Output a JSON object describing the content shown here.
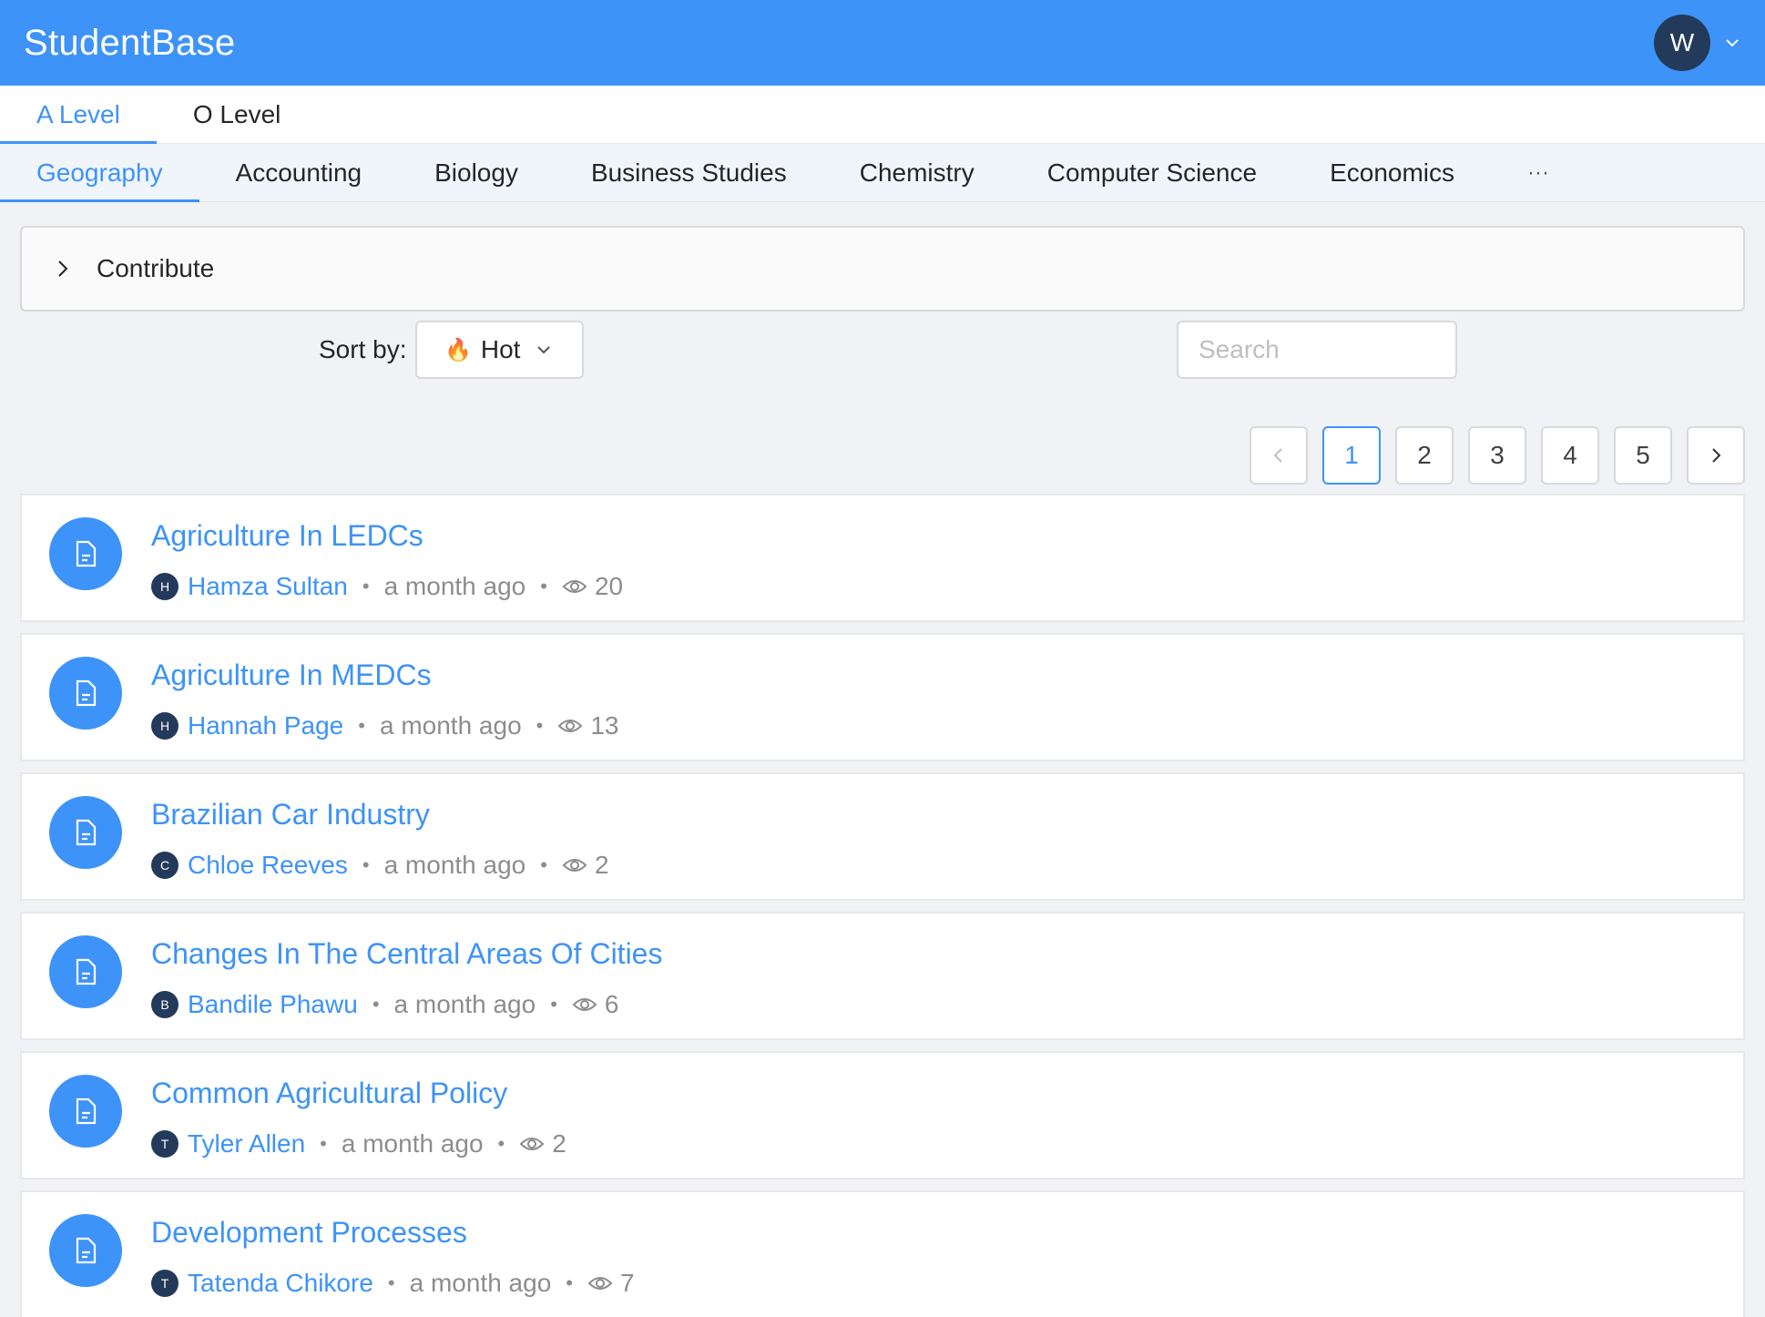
{
  "header": {
    "brand": "StudentBase",
    "user_initial": "W"
  },
  "level_tabs": [
    {
      "label": "A Level",
      "active": true
    },
    {
      "label": "O Level",
      "active": false
    }
  ],
  "subject_tabs": [
    {
      "label": "Geography",
      "active": true
    },
    {
      "label": "Accounting",
      "active": false
    },
    {
      "label": "Biology",
      "active": false
    },
    {
      "label": "Business Studies",
      "active": false
    },
    {
      "label": "Chemistry",
      "active": false
    },
    {
      "label": "Computer Science",
      "active": false
    },
    {
      "label": "Economics",
      "active": false
    }
  ],
  "subject_more": "···",
  "contribute": {
    "label": "Contribute"
  },
  "sort": {
    "label": "Sort by:",
    "icon": "🔥",
    "value": "Hot"
  },
  "search": {
    "placeholder": "Search",
    "value": ""
  },
  "pagination": {
    "pages": [
      "1",
      "2",
      "3",
      "4",
      "5"
    ],
    "current": "1"
  },
  "items": [
    {
      "title": "Agriculture In LEDCs",
      "author_initial": "H",
      "author": "Hamza Sultan",
      "time": "a month ago",
      "views": "20"
    },
    {
      "title": "Agriculture In MEDCs",
      "author_initial": "H",
      "author": "Hannah Page",
      "time": "a month ago",
      "views": "13"
    },
    {
      "title": "Brazilian Car Industry",
      "author_initial": "C",
      "author": "Chloe Reeves",
      "time": "a month ago",
      "views": "2"
    },
    {
      "title": "Changes In The Central Areas Of Cities",
      "author_initial": "B",
      "author": "Bandile Phawu",
      "time": "a month ago",
      "views": "6"
    },
    {
      "title": "Common Agricultural Policy",
      "author_initial": "T",
      "author": "Tyler Allen",
      "time": "a month ago",
      "views": "2"
    },
    {
      "title": "Development Processes",
      "author_initial": "T",
      "author": "Tatenda Chikore",
      "time": "a month ago",
      "views": "7"
    }
  ],
  "colors": {
    "primary": "#3d93f8",
    "avatar": "#243a5a"
  }
}
